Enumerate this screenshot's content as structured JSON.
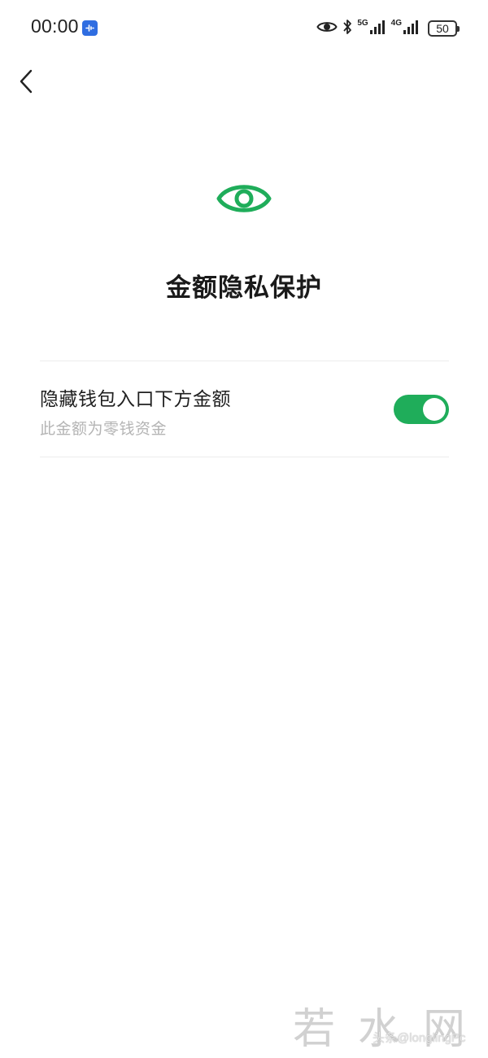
{
  "status_bar": {
    "time": "00:00",
    "net_5g": "5G",
    "net_4g": "4G",
    "battery": "50"
  },
  "page": {
    "title": "金额隐私保护"
  },
  "setting": {
    "title": "隐藏钱包入口下方金额",
    "description": "此金额为零钱资金",
    "enabled": true
  },
  "watermark": {
    "large": "若水网",
    "small": "头条@longlingPc"
  },
  "colors": {
    "accent": "#1fad5a",
    "app_badge": "#2f6de1"
  },
  "icons": {
    "back": "chevron-left-icon",
    "hero": "eye-icon",
    "eye_status": "eye-icon",
    "bluetooth": "bluetooth-icon",
    "signal": "signal-icon",
    "battery": "battery-icon"
  }
}
